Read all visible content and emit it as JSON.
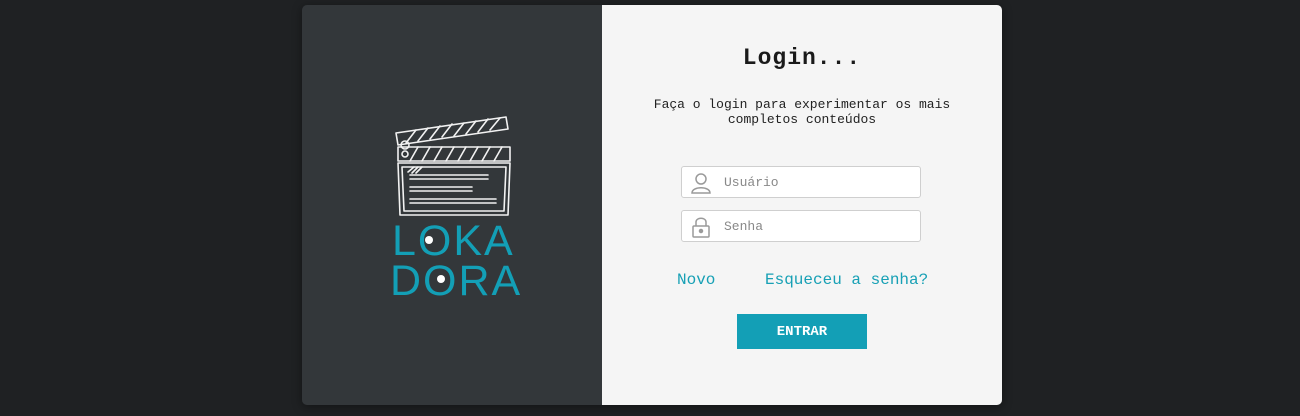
{
  "brand": {
    "logo_line1": "LOKA",
    "logo_line2": "DORA",
    "accent_color": "#139fb6"
  },
  "login": {
    "title": "Login...",
    "subtitle": "Faça o login para experimentar os mais completos conteúdos",
    "username_placeholder": "Usuário",
    "password_placeholder": "Senha",
    "new_link": "Novo",
    "forgot_link": "Esqueceu a senha?",
    "submit_label": "ENTRAR"
  },
  "icons": {
    "username": "user-icon",
    "password": "lock-icon"
  }
}
